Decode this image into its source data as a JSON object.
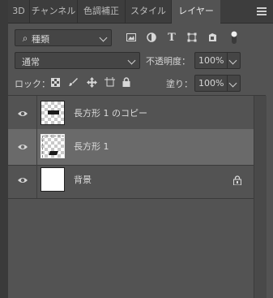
{
  "tabs": [
    {
      "label": "3D"
    },
    {
      "label": "チャンネル"
    },
    {
      "label": "色調補正"
    },
    {
      "label": "スタイル"
    },
    {
      "label": "レイヤー"
    }
  ],
  "filter": {
    "kind_label": "種類"
  },
  "blend": {
    "mode": "通常",
    "opacity_label": "不透明度：",
    "opacity_value": "100%"
  },
  "lock": {
    "label": "ロック：",
    "fill_label": "塗り：",
    "fill_value": "100%"
  },
  "layers": [
    {
      "name": "長方形 1 のコピー"
    },
    {
      "name": "長方形 1"
    },
    {
      "name": "背景"
    }
  ],
  "colors": {
    "panel": "#535353",
    "tabbar": "#3d3d3d",
    "selected": "#6a6a6a"
  }
}
